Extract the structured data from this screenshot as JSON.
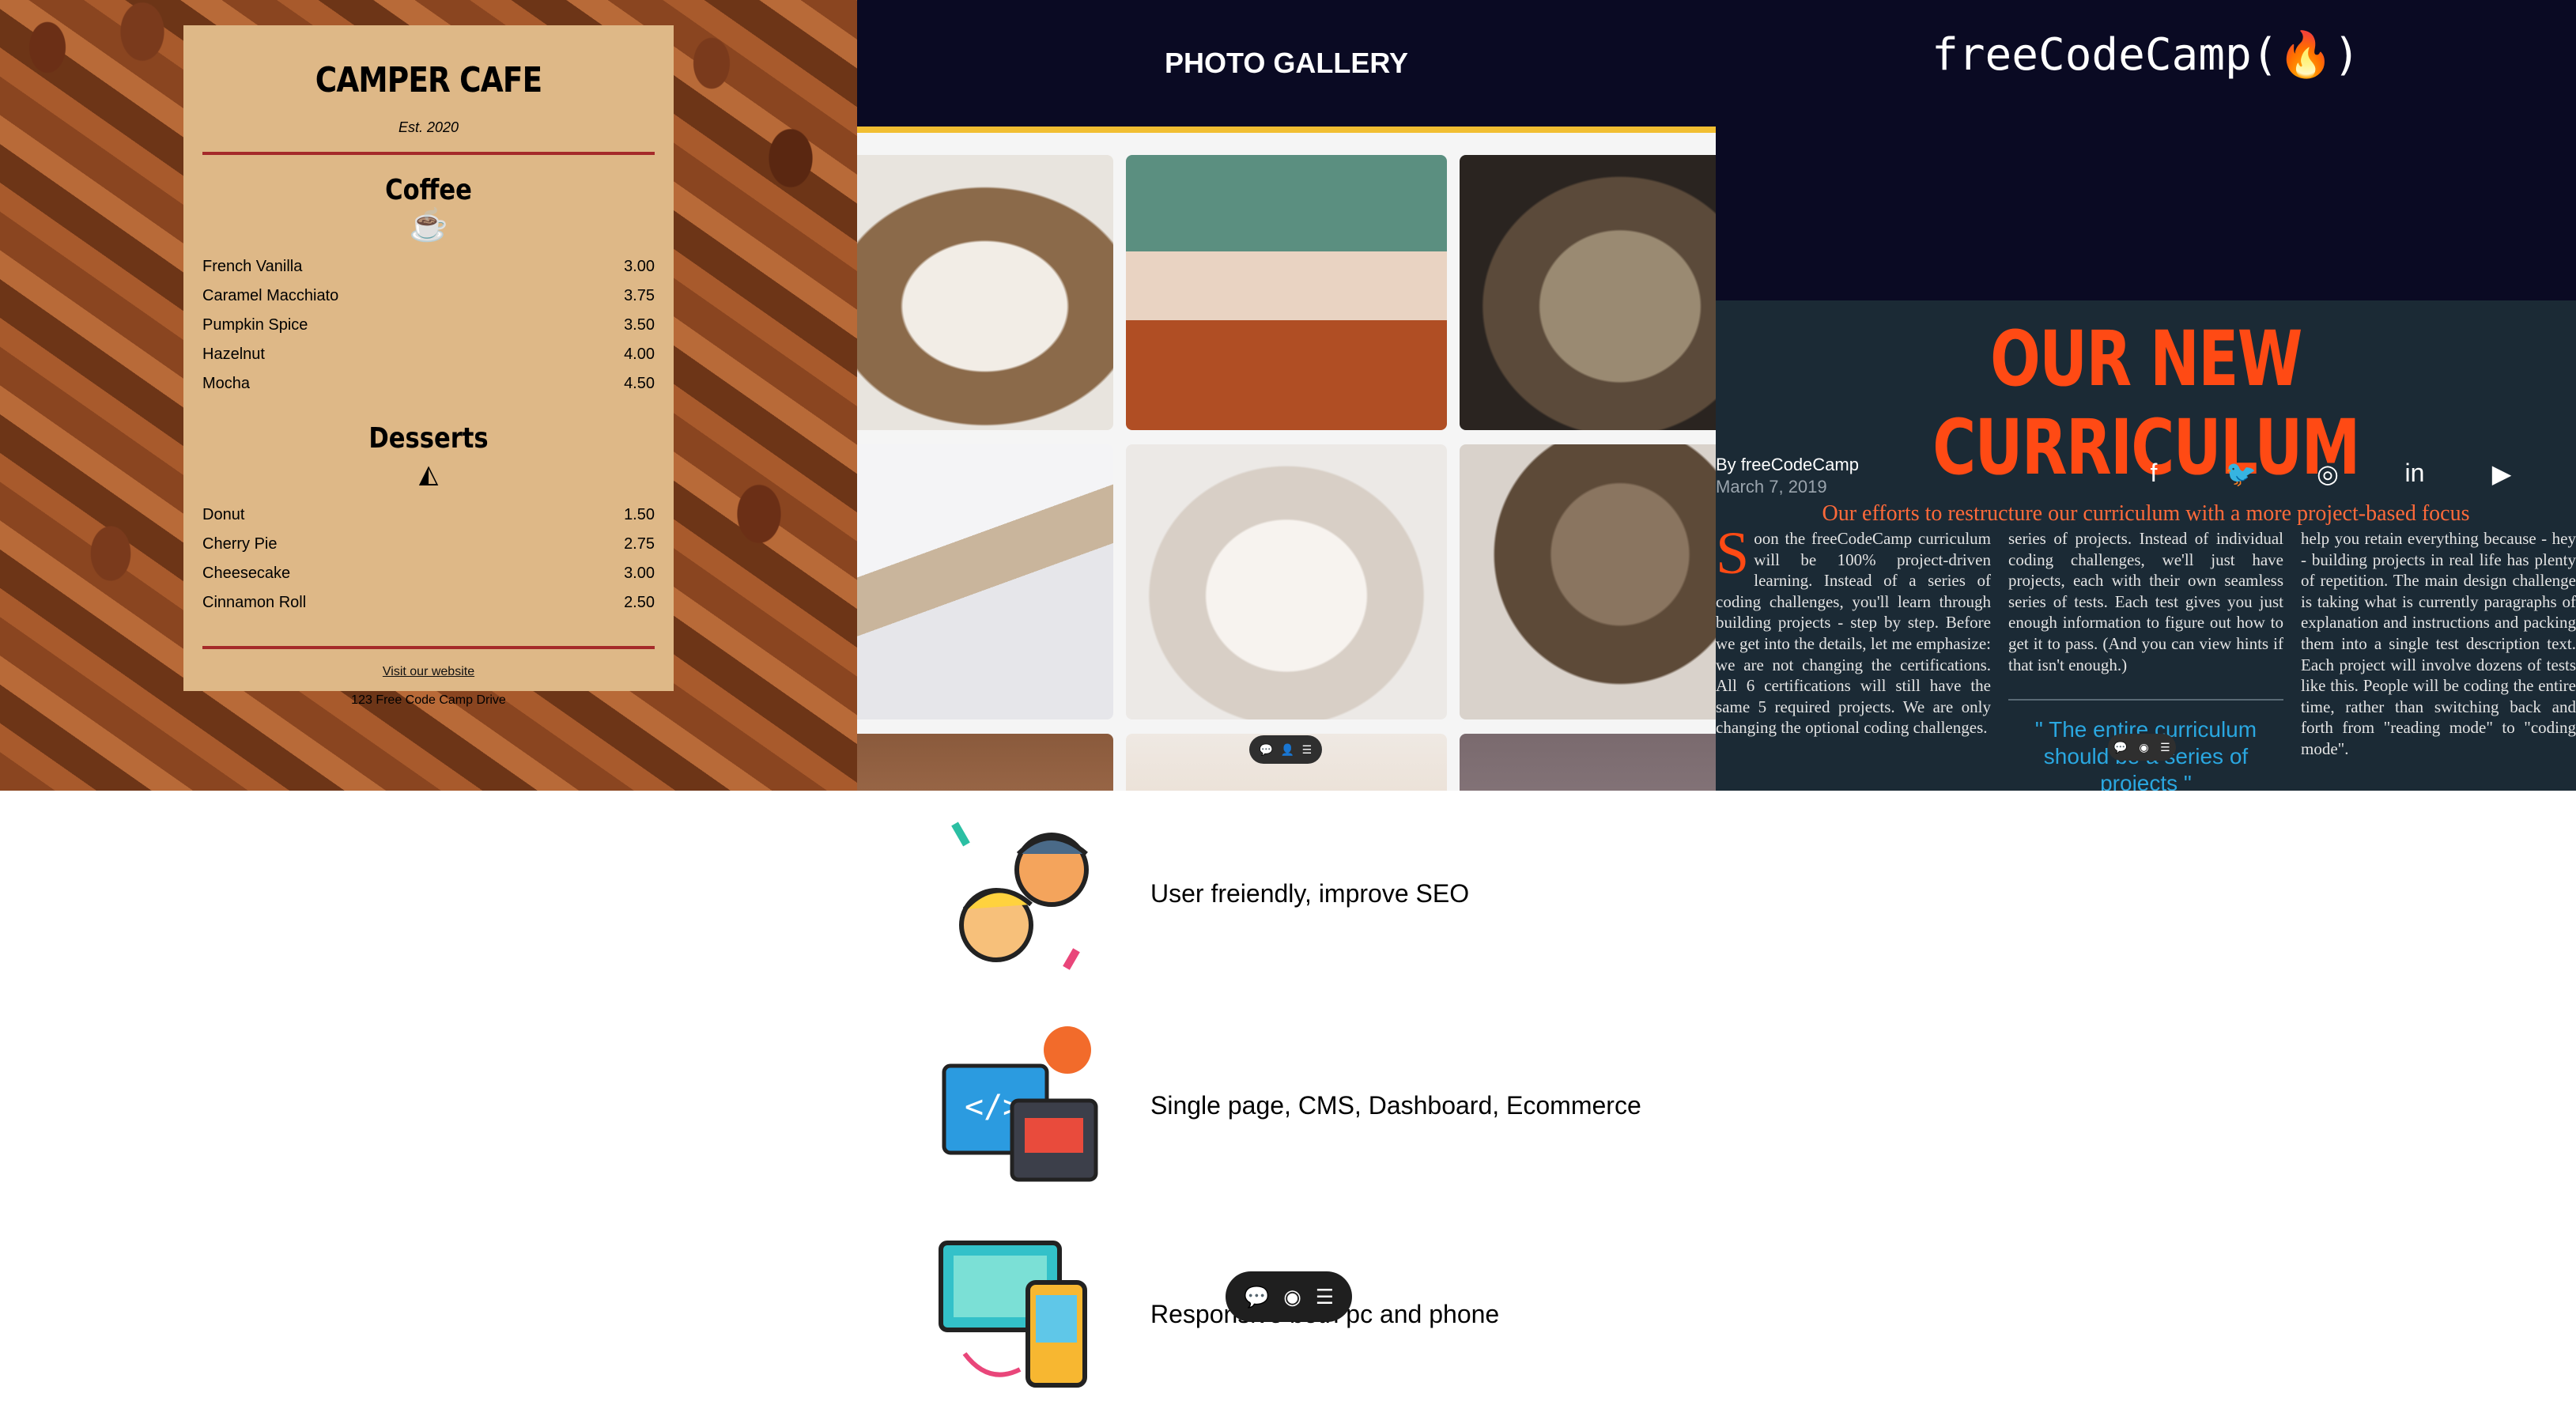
{
  "cafe": {
    "title": "CAMPER CAFE",
    "est": "Est. 2020",
    "coffee_heading": "Coffee",
    "coffee_items": [
      {
        "name": "French Vanilla",
        "price": "3.00"
      },
      {
        "name": "Caramel Macchiato",
        "price": "3.75"
      },
      {
        "name": "Pumpkin Spice",
        "price": "3.50"
      },
      {
        "name": "Hazelnut",
        "price": "4.00"
      },
      {
        "name": "Mocha",
        "price": "4.50"
      }
    ],
    "desserts_heading": "Desserts",
    "dessert_items": [
      {
        "name": "Donut",
        "price": "1.50"
      },
      {
        "name": "Cherry Pie",
        "price": "2.75"
      },
      {
        "name": "Cheesecake",
        "price": "3.00"
      },
      {
        "name": "Cinnamon Roll",
        "price": "2.50"
      }
    ],
    "website_link": "Visit our website",
    "address": "123 Free Code Camp Drive",
    "coffee_icon": "coffee-cup-icon",
    "dessert_icon": "pie-slice-icon"
  },
  "gallery": {
    "title": "PHOTO GALLERY"
  },
  "fcc": {
    "logo": "freeCodeCamp(🔥)",
    "title": "OUR NEW CURRICULUM",
    "subtitle": "Our efforts to restructure our curriculum with a more project-based focus",
    "author": "By freeCodeCamp",
    "date": "March 7, 2019",
    "social": [
      "facebook-icon",
      "twitter-icon",
      "instagram-icon",
      "linkedin-icon",
      "youtube-icon"
    ],
    "col1_drop": "S",
    "col1": "oon the freeCodeCamp curriculum will be 100% project-driven learning. Instead of a series of coding challenges, you'll learn through building projects - step by step. Before we get into the details, let me emphasize: we are not changing the certifications. All 6 certifications will still have the same 5 required projects. We are only changing the optional coding challenges.",
    "col2": "series of projects. Instead of individual coding challenges, we'll just have projects, each with their own seamless series of tests. Each test gives you just enough information to figure out how to get it to pass. (And you can view hints if that isn't enough.)",
    "quote": "\" The entire curriculum should be a series of projects \"",
    "col3": "help you retain everything because - hey - building projects in real life has plenty of repetition. The main design challenge is taking what is currently paragraphs of explanation and instructions and packing them into a single test description text. Each project will involve dozens of tests like this. People will be coding the entire time, rather than switching back and forth from \"reading mode\" to \"coding mode\"."
  },
  "features": [
    {
      "text": "User freiendly, improve SEO",
      "icon": "happy-users-icon"
    },
    {
      "text": "Single page, CMS, Dashboard, Ecommerce",
      "icon": "web-dashboard-icon"
    },
    {
      "text": "Responsive both pc and phone",
      "icon": "responsive-devices-icon"
    }
  ],
  "colors": {
    "cafe_paper": "#deb887",
    "cafe_rule": "#a52a2a",
    "gallery_header": "#0a0a23",
    "gallery_accent": "#f1be32",
    "fcc_accent": "#ff4a14",
    "fcc_quote": "#2aa7e0"
  }
}
